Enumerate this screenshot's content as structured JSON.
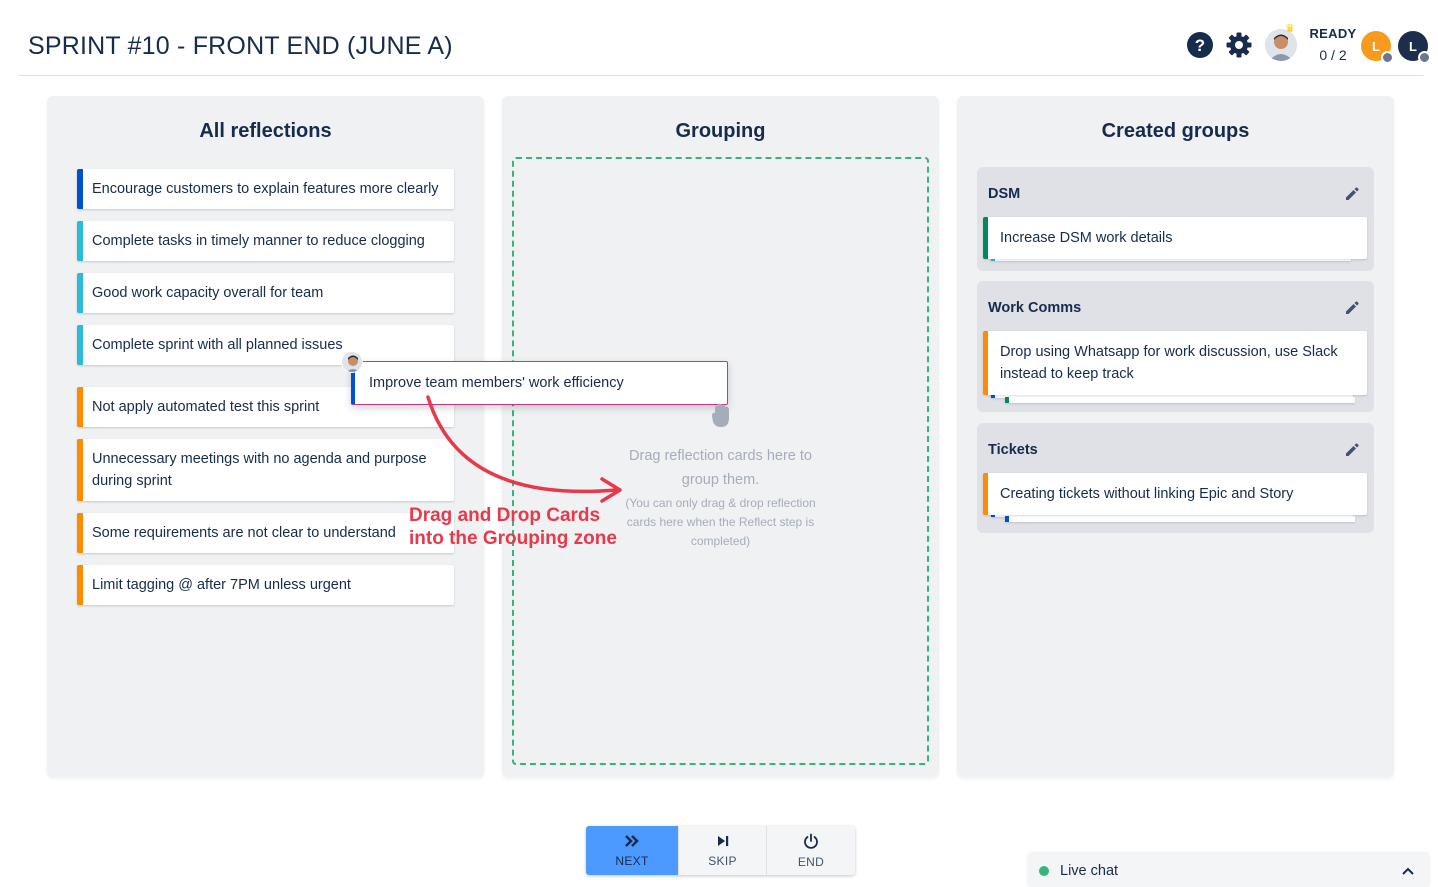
{
  "header": {
    "title": "SPRINT #10 - FRONT END (JUNE A)",
    "ready_label": "READY",
    "ready_count": "0 / 2",
    "avatars": [
      "L",
      "L"
    ]
  },
  "columns": {
    "reflections_title": "All reflections",
    "grouping_title": "Grouping",
    "groups_title": "Created groups"
  },
  "reflections": [
    {
      "text": "Encourage customers to explain features more clearly",
      "color": "#0052cc"
    },
    {
      "text": "Complete tasks in timely manner to reduce clogging",
      "color": "#2bbbd8"
    },
    {
      "text": "Good work capacity overall for team",
      "color": "#2bbbd8"
    },
    {
      "text": "Complete sprint with all planned issues",
      "color": "#2bbbd8"
    },
    {
      "text": "Not apply automated test this sprint",
      "color": "#ff8b00"
    },
    {
      "text": "Unnecessary meetings with no agenda and purpose during sprint",
      "color": "#ff8b00"
    },
    {
      "text": "Some requirements are not clear to understand",
      "color": "#ff8b00"
    },
    {
      "text": "Limit tagging @ after 7PM unless urgent",
      "color": "#ff8b00"
    }
  ],
  "dragging_card": {
    "text": "Improve team members' work efficiency",
    "color": "#0052cc"
  },
  "grouping": {
    "hint_main": "Drag reflection cards here to group them.",
    "hint_sub": "(You can only drag & drop reflection cards here when the Reflect step is completed)"
  },
  "annotation": {
    "line1": "Drag and Drop Cards",
    "line2": "into the Grouping zone"
  },
  "groups": [
    {
      "name": "DSM",
      "card": "Increase DSM work details",
      "card_color": "#00875a"
    },
    {
      "name": "Work Comms",
      "card": "Drop using Whatsapp for work discussion, use Slack instead to keep track",
      "card_color": "#ff8b00"
    },
    {
      "name": "Tickets",
      "card": "Creating tickets without linking Epic and Story",
      "card_color": "#ff8b00"
    }
  ],
  "footer": {
    "next": "NEXT",
    "skip": "SKIP",
    "end": "END"
  },
  "livechat": {
    "label": "Live chat"
  }
}
